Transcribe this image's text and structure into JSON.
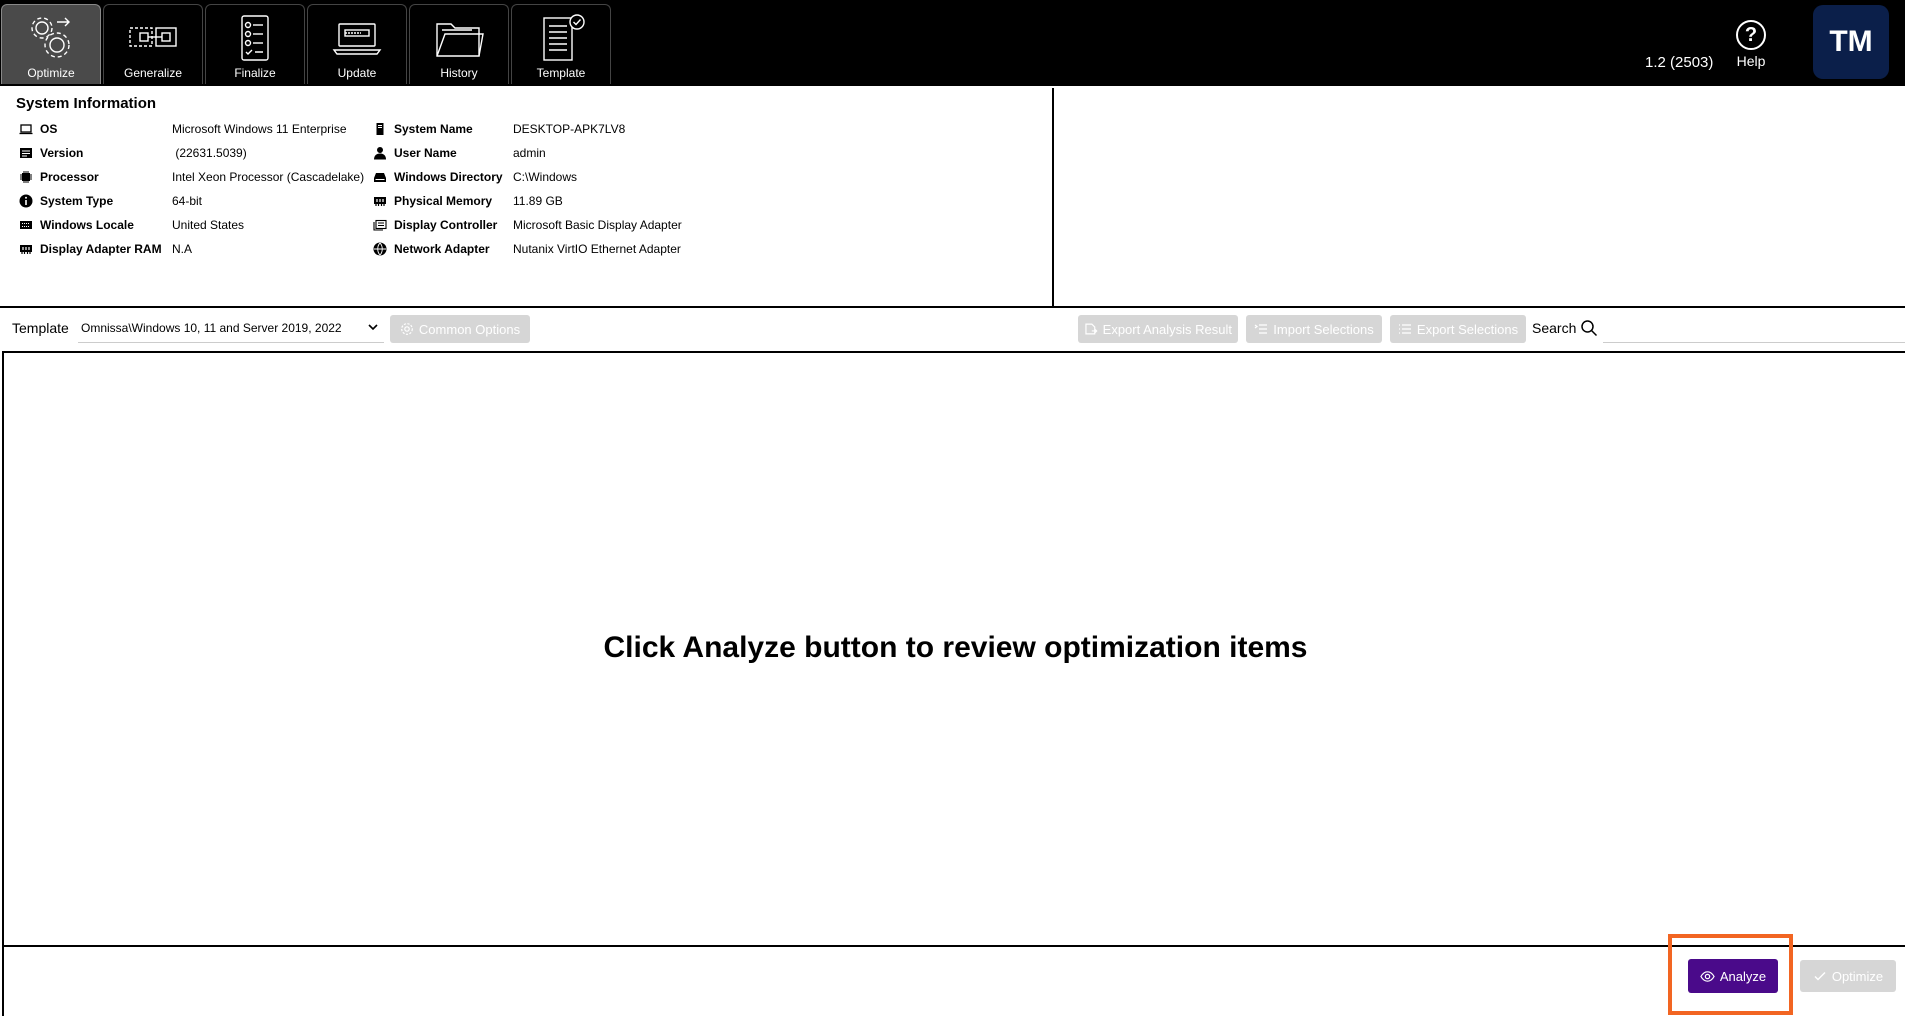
{
  "tabs": [
    {
      "label": "Optimize",
      "icon": "gears-icon",
      "active": true
    },
    {
      "label": "Generalize",
      "icon": "generalize-icon",
      "active": false
    },
    {
      "label": "Finalize",
      "icon": "checklist-icon",
      "active": false
    },
    {
      "label": "Update",
      "icon": "laptop-icon",
      "active": false
    },
    {
      "label": "History",
      "icon": "folder-icon",
      "active": false
    },
    {
      "label": "Template",
      "icon": "document-check-icon",
      "active": false
    }
  ],
  "header": {
    "version": "1.2 (2503)",
    "help_label": "Help",
    "help_glyph": "?",
    "avatar_initials": "TM"
  },
  "system_info": {
    "title": "System Information",
    "left": [
      {
        "label": "OS",
        "value": "Microsoft Windows 11 Enterprise",
        "icon": "laptop-icon"
      },
      {
        "label": "Version",
        "value": " (22631.5039)",
        "icon": "version-icon"
      },
      {
        "label": "Processor",
        "value": "Intel Xeon Processor (Cascadelake)",
        "icon": "cpu-icon"
      },
      {
        "label": "System Type",
        "value": "64-bit",
        "icon": "info-icon"
      },
      {
        "label": "Windows Locale",
        "value": "United States",
        "icon": "keyboard-icon"
      },
      {
        "label": "Display Adapter RAM",
        "value": "N.A",
        "icon": "memory-icon"
      }
    ],
    "right": [
      {
        "label": "System Name",
        "value": "DESKTOP-APK7LV8",
        "icon": "tower-icon"
      },
      {
        "label": "User Name",
        "value": "admin",
        "icon": "user-icon"
      },
      {
        "label": "Windows Directory",
        "value": "C:\\Windows",
        "icon": "drive-icon"
      },
      {
        "label": "Physical Memory",
        "value": "11.89 GB",
        "icon": "memory-icon"
      },
      {
        "label": "Display Controller",
        "value": "Microsoft Basic Display Adapter",
        "icon": "display-icon"
      },
      {
        "label": "Network Adapter",
        "value": "Nutanix VirtIO Ethernet Adapter",
        "icon": "network-icon"
      }
    ]
  },
  "toolbar": {
    "template_label": "Template",
    "template_value": "Omnissa\\Windows 10, 11 and Server 2019, 2022",
    "common_options": "Common Options",
    "export_analysis": "Export Analysis Result",
    "import_selections": "Import Selections",
    "export_selections": "Export Selections",
    "search_label": "Search",
    "search_value": ""
  },
  "main": {
    "empty_message": "Click Analyze button to review optimization items"
  },
  "footer": {
    "analyze_label": "Analyze",
    "optimize_label": "Optimize"
  },
  "colors": {
    "analyze_bg": "#4a0a8a",
    "highlight": "#f26522",
    "avatar_bg": "#0b1f4a",
    "disabled_bg": "#d6d6d6"
  }
}
